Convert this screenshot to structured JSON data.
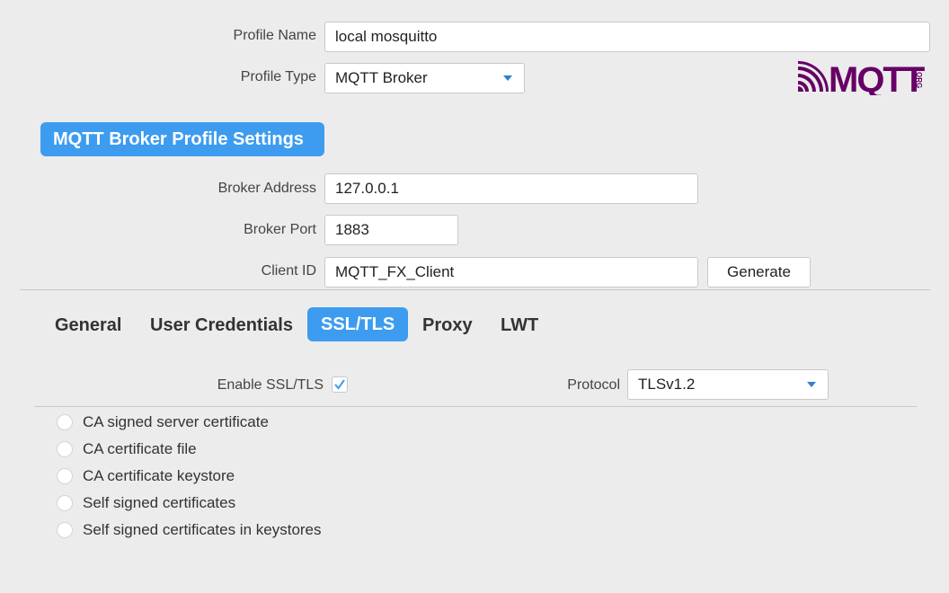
{
  "profile": {
    "name_label": "Profile Name",
    "name_value": "local mosquitto",
    "type_label": "Profile Type",
    "type_value": "MQTT Broker"
  },
  "logo": {
    "text": "MQTT",
    "suffix": "ORG",
    "color": "#660066"
  },
  "broker_section": {
    "title": "MQTT Broker Profile Settings",
    "address_label": "Broker Address",
    "address_value": "127.0.0.1",
    "port_label": "Broker Port",
    "port_value": "1883",
    "client_id_label": "Client ID",
    "client_id_value": "MQTT_FX_Client",
    "generate_label": "Generate"
  },
  "tabs": [
    {
      "label": "General",
      "active": false
    },
    {
      "label": "User Credentials",
      "active": false
    },
    {
      "label": "SSL/TLS",
      "active": true
    },
    {
      "label": "Proxy",
      "active": false
    },
    {
      "label": "LWT",
      "active": false
    }
  ],
  "ssl": {
    "enable_label": "Enable SSL/TLS",
    "enabled": true,
    "protocol_label": "Protocol",
    "protocol_value": "TLSv1.2",
    "options": [
      "CA signed server certificate",
      "CA certificate file",
      "CA certificate keystore",
      "Self signed certificates",
      "Self signed certificates in keystores"
    ]
  },
  "colors": {
    "accent": "#3d9cef",
    "background": "#ececec"
  }
}
